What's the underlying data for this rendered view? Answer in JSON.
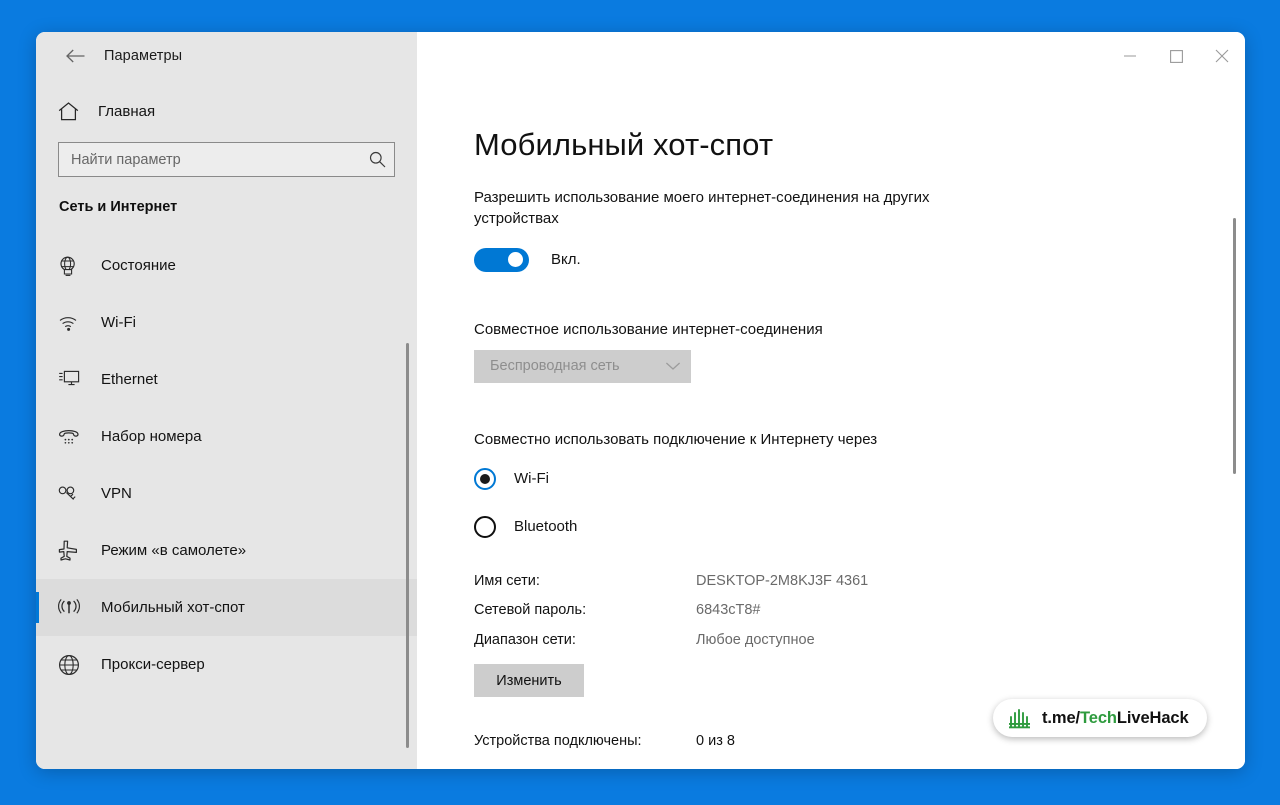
{
  "desktop": {
    "background_color": "#0A7BE0"
  },
  "titlebar": {
    "back_label": "back-arrow",
    "app_title": "Параметры",
    "minimize_label": "Свернуть",
    "maximize_label": "Развернуть",
    "close_label": "Закрыть"
  },
  "sidebar": {
    "home_label": "Главная",
    "search": {
      "placeholder": "Найти параметр",
      "value": ""
    },
    "group_title": "Сеть и Интернет",
    "items": [
      {
        "label": "Состояние",
        "icon": "globe-monitor-icon",
        "selected": false
      },
      {
        "label": "Wi-Fi",
        "icon": "wifi-icon",
        "selected": false
      },
      {
        "label": "Ethernet",
        "icon": "ethernet-icon",
        "selected": false
      },
      {
        "label": "Набор номера",
        "icon": "dialup-phone-icon",
        "selected": false
      },
      {
        "label": "VPN",
        "icon": "vpn-key-icon",
        "selected": false
      },
      {
        "label": "Режим «в самолете»",
        "icon": "airplane-icon",
        "selected": false
      },
      {
        "label": "Мобильный хот-спот",
        "icon": "hotspot-icon",
        "selected": true
      },
      {
        "label": "Прокси-сервер",
        "icon": "globe-icon",
        "selected": false
      }
    ]
  },
  "main": {
    "page_title": "Мобильный хот-спот",
    "description": "Разрешить использование моего интернет-соединения на других устройствах",
    "toggle": {
      "state": "on",
      "label": "Вкл.",
      "accent_color": "#0078D4"
    },
    "sharing_section_label": "Совместное использование интернет-соединения",
    "sharing_dropdown": {
      "selected": "Беспроводная сеть",
      "disabled": true,
      "options": [
        "Беспроводная сеть"
      ]
    },
    "share_via_label": "Совместно использовать подключение к Интернету через",
    "share_via_options": [
      {
        "label": "Wi-Fi",
        "selected": true
      },
      {
        "label": "Bluetooth",
        "selected": false
      }
    ],
    "info": [
      {
        "key": "Имя сети:",
        "value": "DESKTOP-2M8KJ3F 4361"
      },
      {
        "key": "Сетевой пароль:",
        "value": "6843cT8#"
      },
      {
        "key": "Диапазон сети:",
        "value": "Любое доступное"
      }
    ],
    "change_button": "Изменить",
    "devices": {
      "key": "Устройства подключены:",
      "value": "0 из 8"
    }
  },
  "watermark": {
    "prefix": "t.me/",
    "highlight": "Tech",
    "suffix": "LiveHack",
    "highlight_color": "#2E9B3E"
  }
}
